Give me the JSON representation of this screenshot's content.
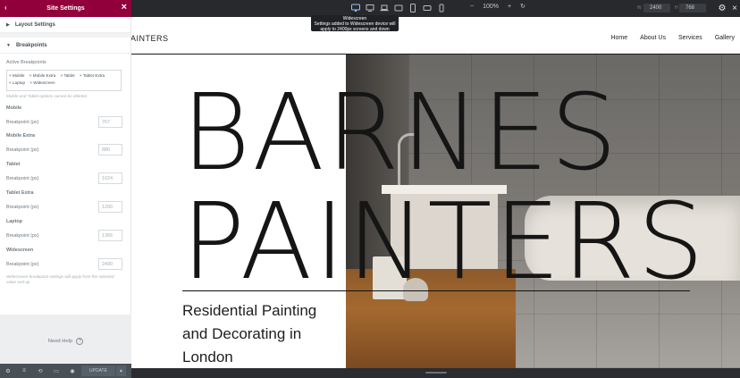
{
  "panel": {
    "title": "Site Settings",
    "layout_section": "Layout Settings",
    "breakpoints_section": "Breakpoints",
    "active_label": "Active Breakpoints",
    "active_tags": [
      "× Mobile",
      "× Mobile Extra",
      "× Tablet",
      "× Tablet Extra",
      "× Laptop",
      "× Widescreen"
    ],
    "note_top": "Mobile and Tablet options cannot be deleted.",
    "breakpoints": [
      {
        "title": "Mobile",
        "label": "Breakpoint (px)",
        "value": "767"
      },
      {
        "title": "Mobile Extra",
        "label": "Breakpoint (px)",
        "value": "880"
      },
      {
        "title": "Tablet",
        "label": "Breakpoint (px)",
        "value": "1024"
      },
      {
        "title": "Tablet Extra",
        "label": "Breakpoint (px)",
        "value": "1200"
      },
      {
        "title": "Laptop",
        "label": "Breakpoint (px)",
        "value": "1366"
      },
      {
        "title": "Widescreen",
        "label": "Breakpoint (px)",
        "value": "2400"
      }
    ],
    "note_bottom": "Widescreen breakpoint settings will apply from the selected value and up",
    "need_help": "Need Help",
    "update_label": "UPDATE"
  },
  "toolbar": {
    "zoom": "100%",
    "width_label": "W",
    "width_value": "2400",
    "height_label": "H",
    "height_value": "768",
    "tooltip_title": "Widescreen",
    "tooltip_text": "Settings added to Widescreen device will apply to 2400px screens and down",
    "devices": [
      "widescreen",
      "desktop",
      "laptop",
      "tablet-extra",
      "tablet",
      "mobile-extra",
      "mobile"
    ]
  },
  "site": {
    "logo": "AINTERS",
    "nav": [
      "Home",
      "About Us",
      "Services",
      "Gallery"
    ],
    "hero_line1": "BARNES",
    "hero_line2": "PAINTERS",
    "hero_sub": "Residential Painting and Decorating in London"
  },
  "colors": {
    "accent": "#92003b",
    "panel_footer": "#495157",
    "toolbar": "#27292d"
  }
}
